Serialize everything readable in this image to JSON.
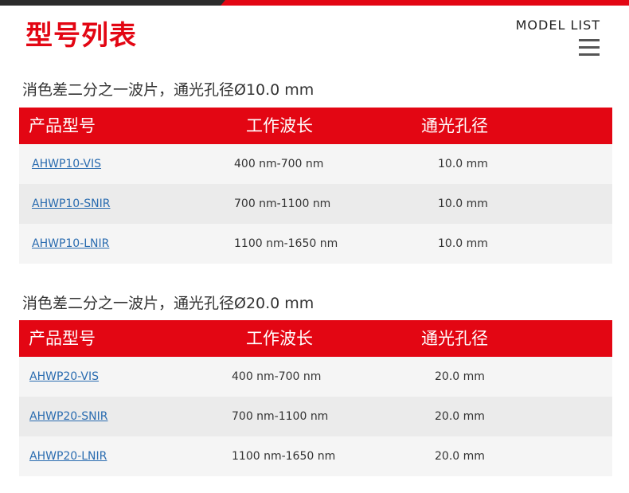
{
  "header": {
    "title": "型号列表",
    "model_list_label": "MODEL LIST",
    "menu_icon": "hamburger-menu-icon"
  },
  "accent_color": "#e30613",
  "columns": [
    "产品型号",
    "工作波长",
    "通光孔径"
  ],
  "sections": [
    {
      "heading": "消色差二分之一波片，通光孔径Ø10.0 mm",
      "rows": [
        {
          "model": "AHWP10-VIS",
          "wavelength": "400 nm-700 nm",
          "aperture": "10.0 mm"
        },
        {
          "model": "AHWP10-SNIR",
          "wavelength": "700 nm-1100 nm",
          "aperture": "10.0 mm"
        },
        {
          "model": "AHWP10-LNIR",
          "wavelength": "1100 nm-1650 nm",
          "aperture": "10.0 mm"
        }
      ]
    },
    {
      "heading": "消色差二分之一波片，通光孔径Ø20.0 mm",
      "rows": [
        {
          "model": "AHWP20-VIS",
          "wavelength": "400 nm-700 nm",
          "aperture": "20.0 mm"
        },
        {
          "model": "AHWP20-SNIR",
          "wavelength": "700 nm-1100 nm",
          "aperture": "20.0 mm"
        },
        {
          "model": "AHWP20-LNIR",
          "wavelength": "1100 nm-1650 nm",
          "aperture": "20.0 mm"
        }
      ]
    }
  ]
}
